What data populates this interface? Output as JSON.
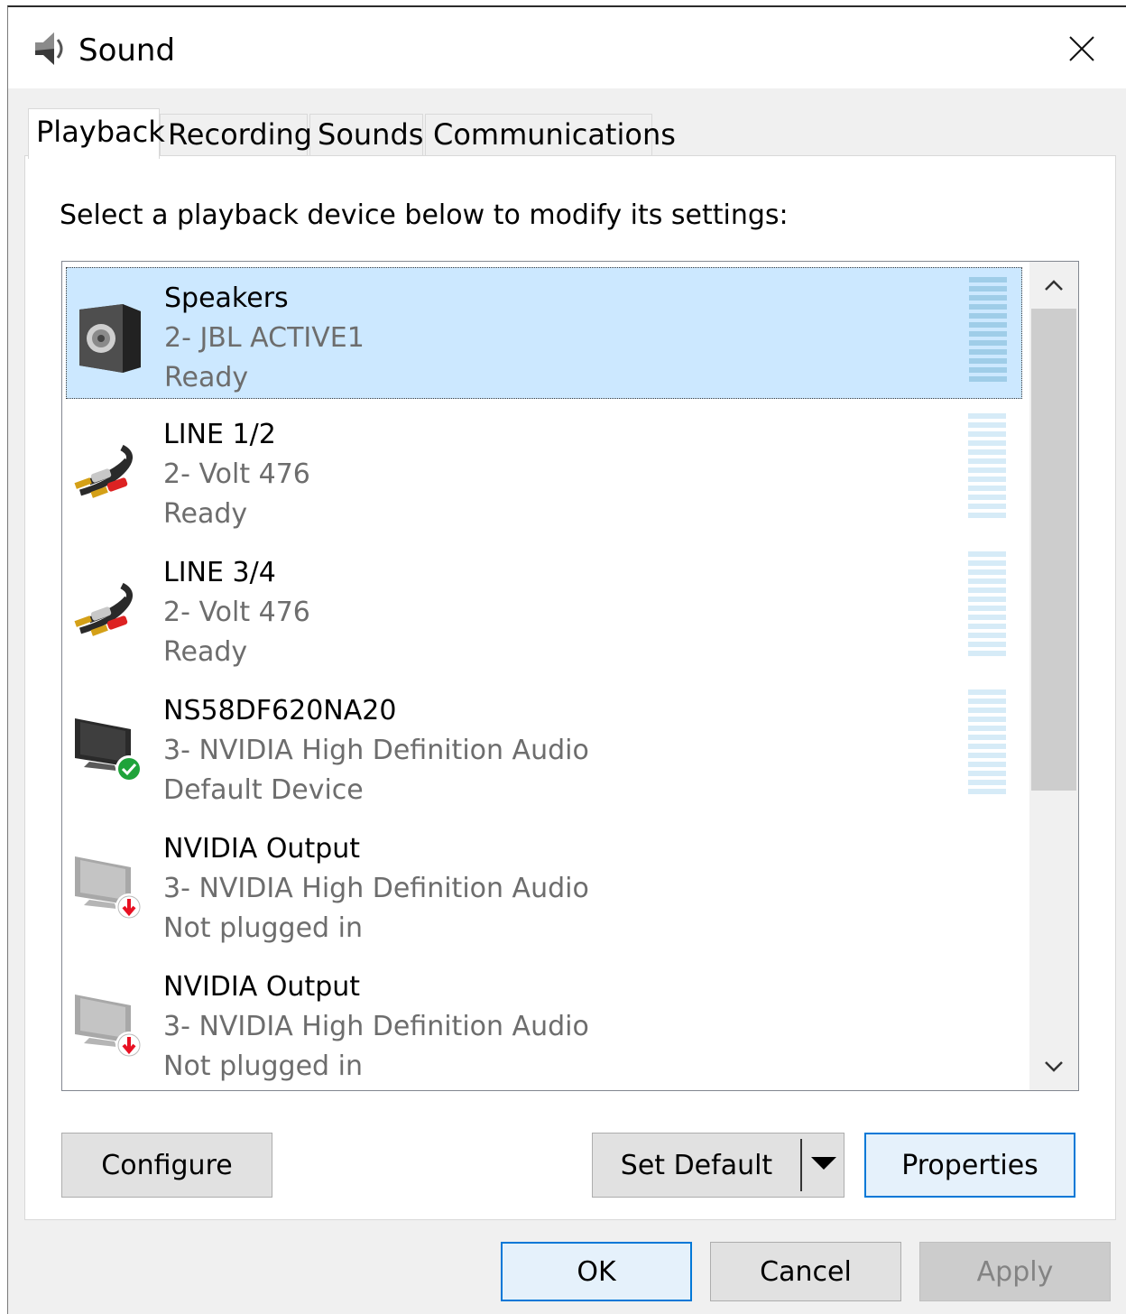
{
  "window": {
    "title": "Sound",
    "title_icon": "speaker-icon",
    "close_icon": "close-icon"
  },
  "tabs": [
    {
      "label": "Playback",
      "active": true
    },
    {
      "label": "Recording",
      "active": false
    },
    {
      "label": "Sounds",
      "active": false
    },
    {
      "label": "Communications",
      "active": false
    }
  ],
  "playback": {
    "instruction": "Select a playback device below to modify its settings:",
    "devices": [
      {
        "name": "Speakers",
        "description": "2- JBL ACTIVE1",
        "status": "Ready",
        "icon": "speaker-box-icon",
        "selected": true,
        "meter": true
      },
      {
        "name": "LINE 1/2",
        "description": "2- Volt 476",
        "status": "Ready",
        "icon": "rca-cable-icon",
        "selected": false,
        "meter": true
      },
      {
        "name": "LINE 3/4",
        "description": "2- Volt 476",
        "status": "Ready",
        "icon": "rca-cable-icon",
        "selected": false,
        "meter": true
      },
      {
        "name": "NS58DF620NA20",
        "description": "3- NVIDIA High Definition Audio",
        "status": "Default Device",
        "icon": "monitor-default-icon",
        "selected": false,
        "meter": true
      },
      {
        "name": "NVIDIA Output",
        "description": "3- NVIDIA High Definition Audio",
        "status": "Not plugged in",
        "icon": "monitor-unplugged-icon",
        "selected": false,
        "meter": false
      },
      {
        "name": "NVIDIA Output",
        "description": "3- NVIDIA High Definition Audio",
        "status": "Not plugged in",
        "icon": "monitor-unplugged-icon",
        "selected": false,
        "meter": false
      }
    ],
    "buttons": {
      "configure": "Configure",
      "set_default": "Set Default",
      "properties": "Properties"
    }
  },
  "footer": {
    "ok": "OK",
    "cancel": "Cancel",
    "apply": "Apply"
  },
  "colors": {
    "selection": "#cce8ff",
    "accent": "#0078d7",
    "meter_active": "#9fcde8",
    "meter_idle": "#d6ebf7",
    "default_check": "#1fa33a",
    "unplugged_arrow": "#e81123"
  }
}
